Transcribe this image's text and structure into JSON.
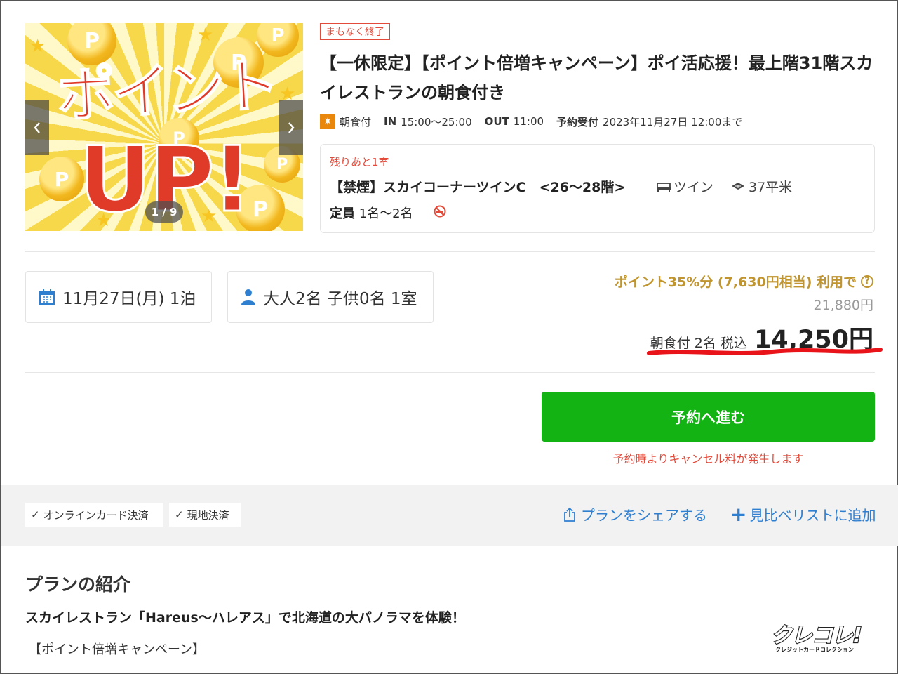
{
  "carousel": {
    "promo_text_line1": "ポイント",
    "promo_text_line2": "UP!",
    "coin_letter": "P",
    "counter": "1 / 9",
    "prev_icon": "chevron-left-icon",
    "next_icon": "chevron-right-icon"
  },
  "plan": {
    "status_badge": "まもなく終了",
    "title": "【一休限定】【ポイント倍増キャンペーン】ポイ活応援！最上階31階スカイレストランの朝食付き",
    "meal_label": "朝食付",
    "checkin_label": "IN",
    "checkin_value": "15:00〜25:00",
    "checkout_label": "OUT",
    "checkout_value": "11:00",
    "deadline_label": "予約受付",
    "deadline_value": "2023年11月27日 12:00まで"
  },
  "room": {
    "availability": "残りあと1室",
    "name": "【禁煙】スカイコーナーツインC　<26〜28階>",
    "bed_type": "ツイン",
    "area": "37平米",
    "capacity_label": "定員",
    "capacity_value": "1名〜2名"
  },
  "search": {
    "date": "11月27日(月) 1泊",
    "guests": "大人2名 子供0名 1室"
  },
  "price": {
    "point_note": "ポイント35%分 (7,630円相当) 利用で",
    "help_icon_glyph": "?",
    "original": "21,880円",
    "label": "朝食付 2名 税込",
    "final": "14,250円"
  },
  "reserve": {
    "button_label": "予約へ進む",
    "cancel_note": "予約時よりキャンセル料が発生します"
  },
  "payment": {
    "online": "オンラインカード決済",
    "local": "現地決済",
    "check_glyph": "✓"
  },
  "actions": {
    "share": "プランをシェアする",
    "compare": "見比べリストに追加",
    "compare_glyph": "+"
  },
  "intro": {
    "heading": "プランの紹介",
    "subheading": "スカイレストラン「Hareus〜ハレアス」で北海道の大パノラマを体験！",
    "body": "【ポイント倍増キャンペーン】"
  },
  "watermark": {
    "logo_text": "クレコレ!",
    "logo_sub": "クレジットカードコレクション"
  },
  "colors": {
    "accent_red": "#e34a3a",
    "gold": "#c09530",
    "reserve_green": "#12b312",
    "link_blue": "#2f7fd1",
    "meal_orange": "#e8870c"
  }
}
